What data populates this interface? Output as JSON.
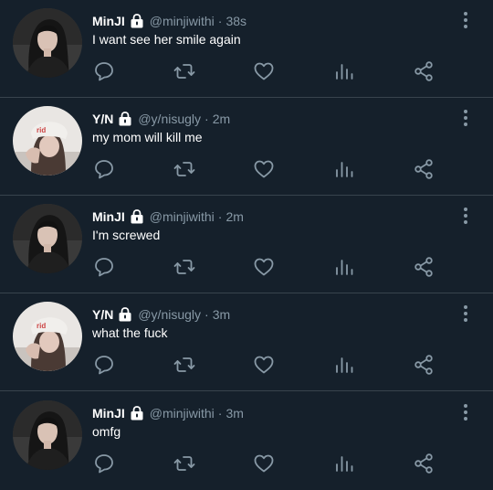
{
  "tweets": [
    {
      "name": "MinJI",
      "handle": "@minjiwithi",
      "separator": "·",
      "time": "38s",
      "text": "I want see her smile again",
      "avatar": "minji-avatar"
    },
    {
      "name": "Y/N",
      "handle": "@y/nisugly",
      "separator": "·",
      "time": "2m",
      "text": "my mom will kill me",
      "avatar": "yn-avatar"
    },
    {
      "name": "MinJI",
      "handle": "@minjiwithi",
      "separator": "·",
      "time": "2m",
      "text": "I'm screwed",
      "avatar": "minji-avatar"
    },
    {
      "name": "Y/N",
      "handle": "@y/nisugly",
      "separator": "·",
      "time": "3m",
      "text": "what the fuck",
      "avatar": "yn-avatar"
    },
    {
      "name": "MinJI",
      "handle": "@minjiwithi",
      "separator": "·",
      "time": "3m",
      "text": "omfg",
      "avatar": "minji-avatar"
    }
  ],
  "icons": {
    "verified": "lock-icon",
    "reply": "reply-icon",
    "retweet": "retweet-icon",
    "like": "heart-icon",
    "stats": "stats-icon",
    "share": "share-icon",
    "more": "more-icon"
  },
  "colors": {
    "background": "#15202b",
    "divider": "#38444d",
    "secondary_text": "#8899a6",
    "primary_text": "#ffffff"
  }
}
